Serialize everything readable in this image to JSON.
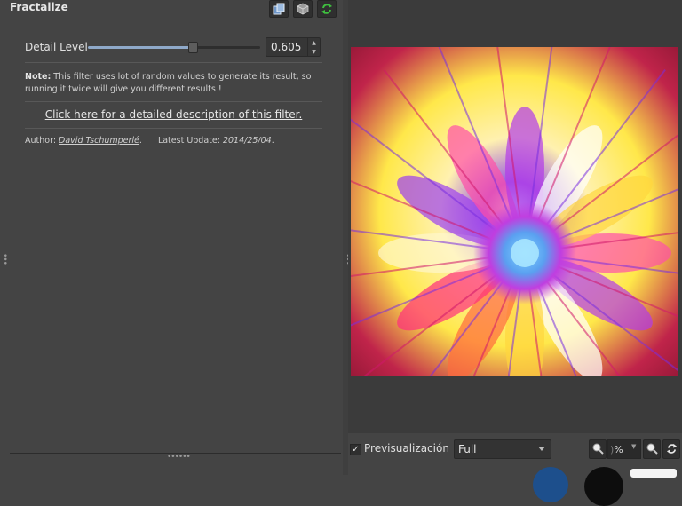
{
  "filter": {
    "title": "Fractalize",
    "param": {
      "label": "Detail Level",
      "value": "0.605",
      "slider_fraction": 0.605
    },
    "note_title": "Note:",
    "note_text": " This filter uses lot of random values to generate its result, so running it twice will give you different results !",
    "link_text": "Click here for a detailed description of this filter.",
    "author_label": "Author: ",
    "author_name": "David Tschumperlé",
    "author_suffix": ".",
    "update_label": "Latest Update: ",
    "update_date": "2014/25/04",
    "update_suffix": "."
  },
  "toolbar": {
    "icons": [
      "copy-icon",
      "cube-icon",
      "refresh-icon"
    ]
  },
  "preview_bar": {
    "checkbox_mark": "✓",
    "checkbox_label": "Previsualización",
    "mode_value": "Full",
    "zoom_text": "% ",
    "zoom_prefix": ")"
  },
  "colors": {
    "panel_bg": "#444444",
    "preview_bg": "#3b3b3b",
    "slider_fill": "#8fa9c9",
    "refresh_green": "#3fbf3f"
  }
}
